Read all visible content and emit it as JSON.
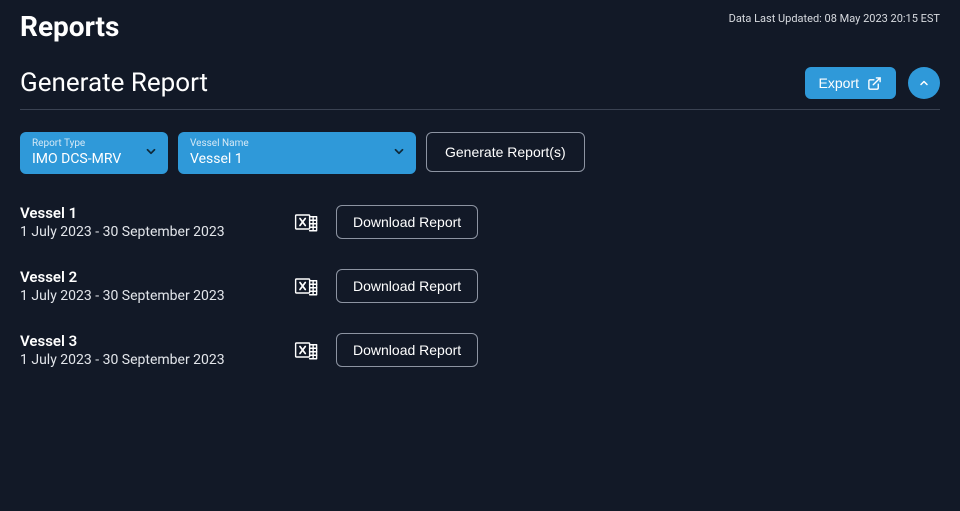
{
  "page_title": "Reports",
  "last_updated": "Data Last Updated: 08 May 2023 20:15 EST",
  "section_title": "Generate Report",
  "export_label": "Export",
  "filters": {
    "report_type": {
      "label": "Report Type",
      "value": "IMO DCS-MRV"
    },
    "vessel_name": {
      "label": "Vessel Name",
      "value": "Vessel 1"
    }
  },
  "generate_label": "Generate Report(s)",
  "download_label": "Download Report",
  "reports": [
    {
      "name": "Vessel 1",
      "range": "1 July 2023 - 30 September 2023"
    },
    {
      "name": "Vessel 2",
      "range": "1 July 2023 - 30 September 2023"
    },
    {
      "name": "Vessel 3",
      "range": "1 July 2023 - 30 September 2023"
    }
  ]
}
